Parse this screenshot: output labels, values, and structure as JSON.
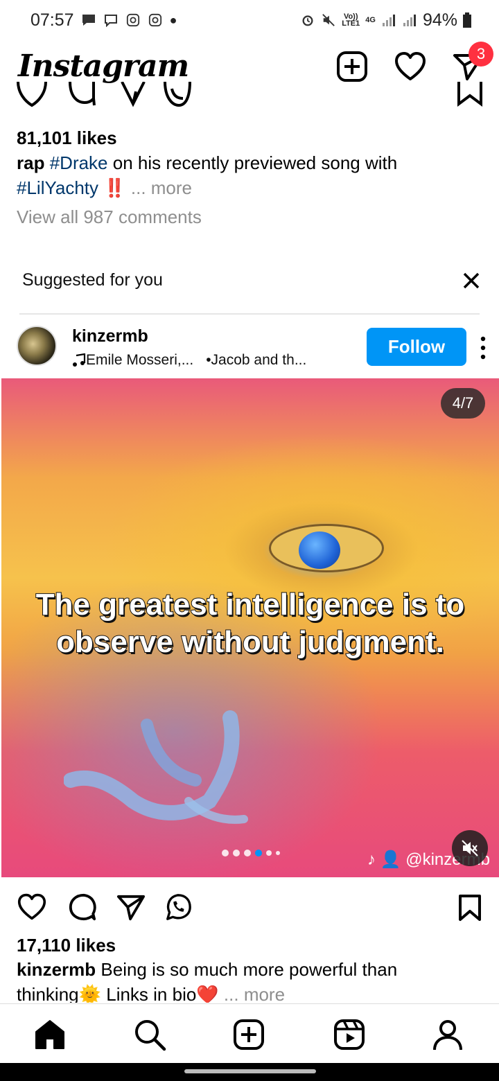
{
  "status_bar": {
    "time": "07:57",
    "network_top": "Vo))",
    "network_bottom": "LTE1",
    "data_type": "4G",
    "battery": "94%"
  },
  "header": {
    "logo": "Instagram",
    "notification_count": "3"
  },
  "previous_post": {
    "likes": "81,101 likes",
    "caption_lead": "rap",
    "tag_drake": "#Drake",
    "caption_mid": "on his recently previewed song with",
    "tag_lilyachty": "#LilYachty",
    "emoji": "‼️",
    "more": "... more",
    "comments": "View all 987 comments"
  },
  "suggested": {
    "title": "Suggested for you"
  },
  "post": {
    "username": "kinzermb",
    "audio": "Emile Mosseri,...",
    "audio_extra": "•Jacob and th...",
    "follow_label": "Follow",
    "counter": "4/7",
    "overlay_line1": "The greatest intelligence is to",
    "overlay_line2": "observe without judgment.",
    "watermark": "@kinzermb",
    "likes": "17,110 likes",
    "caption_user": "kinzermb",
    "caption_line1": "Being is so much more powerful than",
    "caption_word": "thinking",
    "sun_emoji": "🌞",
    "caption_links": "Links in bio",
    "heart_emoji": "❤️",
    "more": "... more",
    "carousel_total": 7,
    "carousel_active": 4
  },
  "colors": {
    "follow": "#0095f6",
    "badge": "#ff3040",
    "hashtag": "#00376b"
  },
  "icons": [
    "new-post-icon",
    "heart-icon",
    "direct-message-icon",
    "comment-icon",
    "share-icon",
    "whatsapp-icon",
    "bookmark-icon",
    "close-icon",
    "more-options-icon",
    "music-note-icon",
    "tiktok-icon",
    "mute-icon",
    "home-icon",
    "search-icon",
    "create-icon",
    "reels-icon",
    "profile-icon"
  ]
}
